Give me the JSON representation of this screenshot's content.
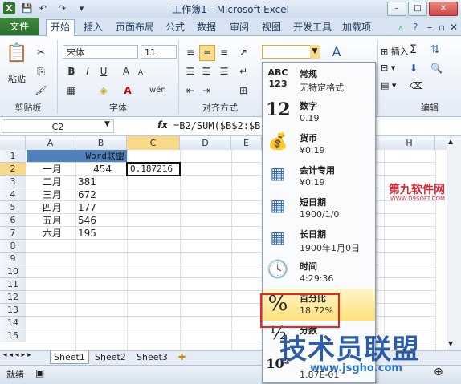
{
  "window": {
    "title": "工作簿1 - Microsoft Excel",
    "min": "–",
    "max": "□",
    "close": "✕"
  },
  "ribbon": {
    "file_tab": "文件",
    "tabs": [
      "开始",
      "插入",
      "页面布局",
      "公式",
      "数据",
      "审阅",
      "视图",
      "开发工具",
      "加载项"
    ],
    "clipboard": {
      "paste": "粘贴",
      "group": "剪贴板"
    },
    "font": {
      "name": "宋体",
      "size": "11",
      "group": "字体",
      "bold": "B",
      "italic": "I",
      "underline": "U",
      "font_color": "A",
      "grow": "A",
      "wen": "wén"
    },
    "alignment": {
      "group": "对齐方式"
    },
    "editing": {
      "group": "编辑",
      "insert": "插入",
      "delete": "删除",
      "format": "格式",
      "sum": "Σ"
    }
  },
  "formula_bar": {
    "name_box": "C2",
    "fx": "fx",
    "formula": "=B2/SUM($B$2:$B"
  },
  "columns": [
    "A",
    "B",
    "C",
    "D",
    "E",
    "H"
  ],
  "rows": [
    "1",
    "2",
    "3",
    "4",
    "5",
    "6",
    "7",
    "8",
    "9",
    "10",
    "11",
    "12",
    "13",
    "14",
    "15"
  ],
  "cells": {
    "B1": "Word联盟",
    "A2": "一月",
    "B2": "454",
    "C2": "0.187216",
    "A3": "二月",
    "B3": "381",
    "A4": "三月",
    "B4": "672",
    "A5": "四月",
    "B5": "177",
    "A6": "五月",
    "B6": "546",
    "A7": "六月",
    "B7": "195"
  },
  "sheets": [
    "Sheet1",
    "Sheet2",
    "Sheet3"
  ],
  "status": {
    "ready": "就绪"
  },
  "number_formats": [
    {
      "name": "常规",
      "value": "无特定格式",
      "icon": "ABC 123"
    },
    {
      "name": "数字",
      "value": "0.19",
      "icon": "12"
    },
    {
      "name": "货币",
      "value": "¥0.19",
      "icon": "coins-icon"
    },
    {
      "name": "会计专用",
      "value": " ¥0.19",
      "icon": "ledger-icon"
    },
    {
      "name": "短日期",
      "value": "1900/1/0",
      "icon": "calendar-icon"
    },
    {
      "name": "长日期",
      "value": "1900年1月0日",
      "icon": "calendar-icon"
    },
    {
      "name": "时间",
      "value": "4:29:36",
      "icon": "clock-icon"
    },
    {
      "name": "百分比",
      "value": "18.72%",
      "icon": "%"
    },
    {
      "name": "分数",
      "value": "",
      "icon": "½"
    },
    {
      "name": "",
      "value": "1.87E-01",
      "icon": "10²"
    }
  ],
  "watermarks": {
    "top": "第九软件网",
    "top_sub": "WWW.D9SOFT.COM",
    "bottom": "技术员联盟",
    "bottom_sub": "www.jsgho.com"
  },
  "colors": {
    "file_tab": "#2a6f2a",
    "selection_highlight": "#ffe07a",
    "red_box": "#e22",
    "header_fill": "#4f81bd"
  }
}
